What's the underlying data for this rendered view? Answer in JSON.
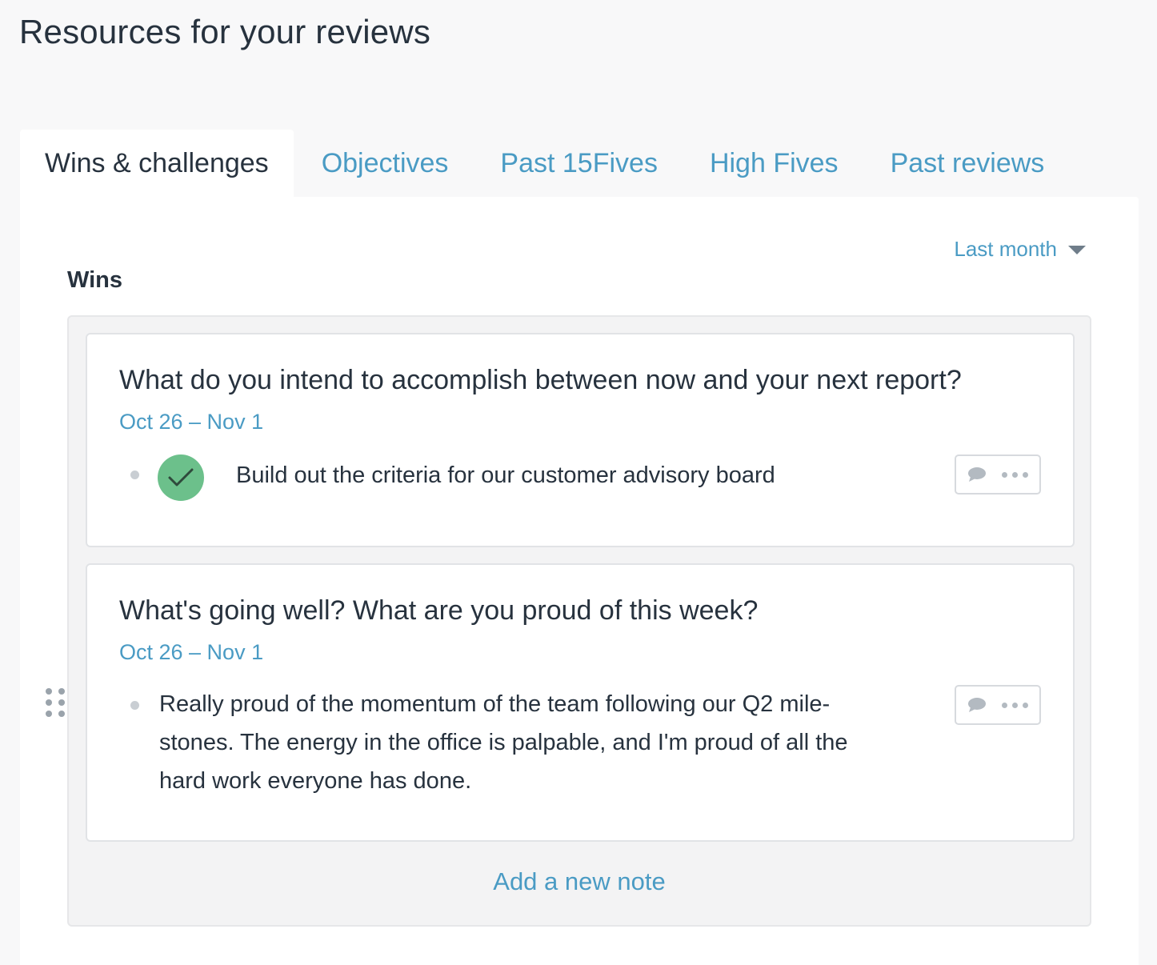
{
  "page": {
    "title": "Resources for your reviews"
  },
  "tabs": [
    {
      "label": "Wins & challenges",
      "active": true
    },
    {
      "label": "Objectives",
      "active": false
    },
    {
      "label": "Past 15Fives",
      "active": false
    },
    {
      "label": "High Fives",
      "active": false
    },
    {
      "label": "Past reviews",
      "active": false
    }
  ],
  "filter": {
    "label": "Last month",
    "icon": "caret-down-icon"
  },
  "wins": {
    "title": "Wins",
    "cards": [
      {
        "question": "What do you intend to accomplish between now and your next report?",
        "date": "Oct 26 – Nov 1",
        "answer": "Build out the criteria for our customer advisory board",
        "completed": true
      },
      {
        "question": "What's going well? What are you proud of this week?",
        "date": "Oct 26 – Nov 1",
        "answer_lines": [
          "Really proud of the momentum of the team following our Q2 mile-",
          "stones. The energy in the office is palpable, and I'm proud of all the",
          "hard work everyone has done."
        ]
      }
    ],
    "add_note_label": "Add a new note"
  },
  "colors": {
    "accent": "#4a9bc4",
    "text": "#27323e",
    "check": "#6cc08b",
    "background": "#f8f8f9"
  }
}
